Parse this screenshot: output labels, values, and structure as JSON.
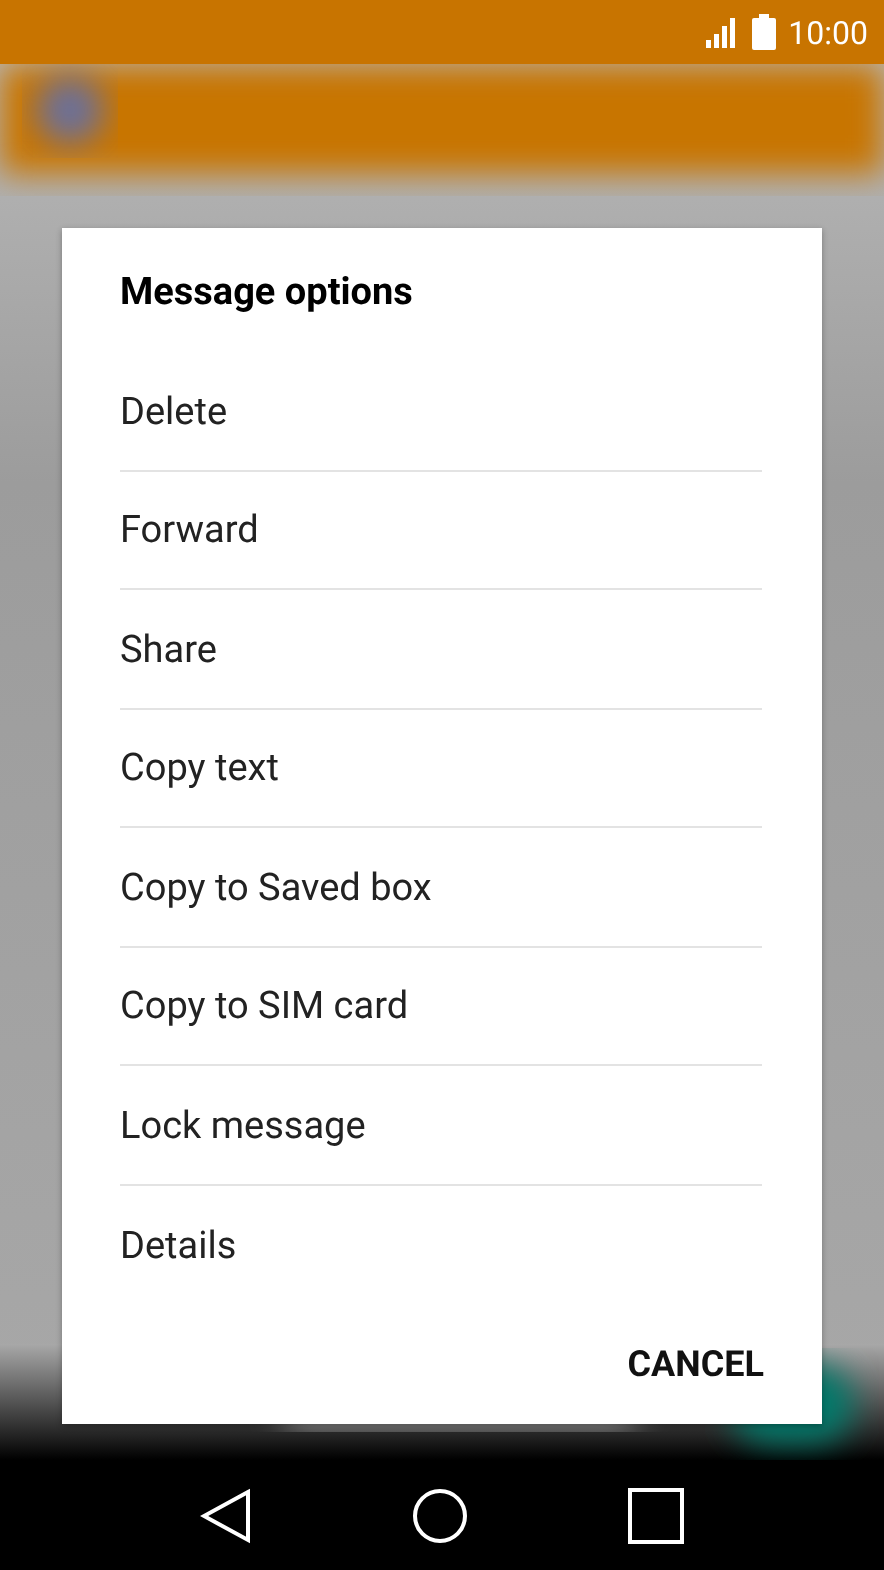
{
  "status_bar": {
    "time": "10:00"
  },
  "dialog": {
    "title": "Message options",
    "options": [
      "Delete",
      "Forward",
      "Share",
      "Copy text",
      "Copy to Saved box",
      "Copy to SIM card",
      "Lock message",
      "Details"
    ],
    "buttons": [
      "CANCEL"
    ]
  }
}
